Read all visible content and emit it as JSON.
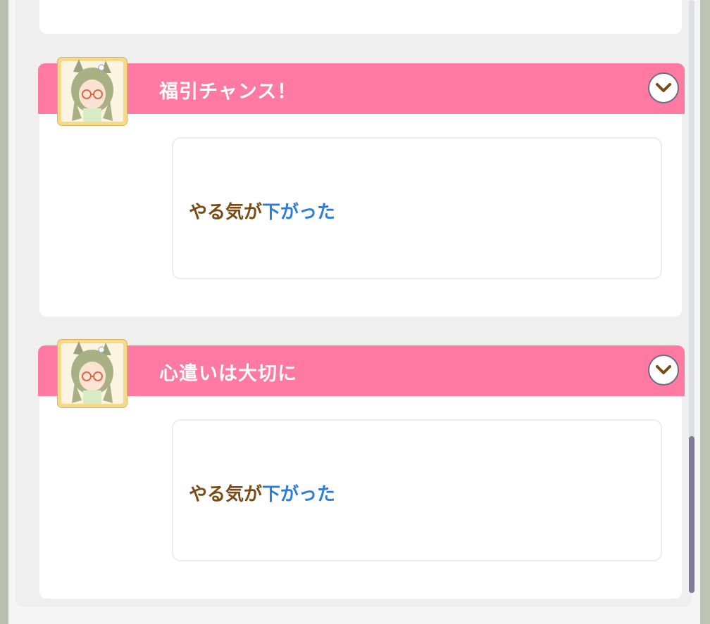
{
  "events": [
    {
      "title": "福引チャンス！",
      "result_main": "やる気が",
      "result_accent": "下がった"
    },
    {
      "title": "心遣いは大切に",
      "result_main": "やる気が",
      "result_accent": "下がった"
    }
  ],
  "colors": {
    "header": "#ff7aa2",
    "result_main": "#7a4b16",
    "result_accent": "#2e7ddc",
    "scroll_thumb": "#7d7b98"
  },
  "icons": {
    "toggle": "chevron-down-icon",
    "avatar": "character-portrait"
  }
}
